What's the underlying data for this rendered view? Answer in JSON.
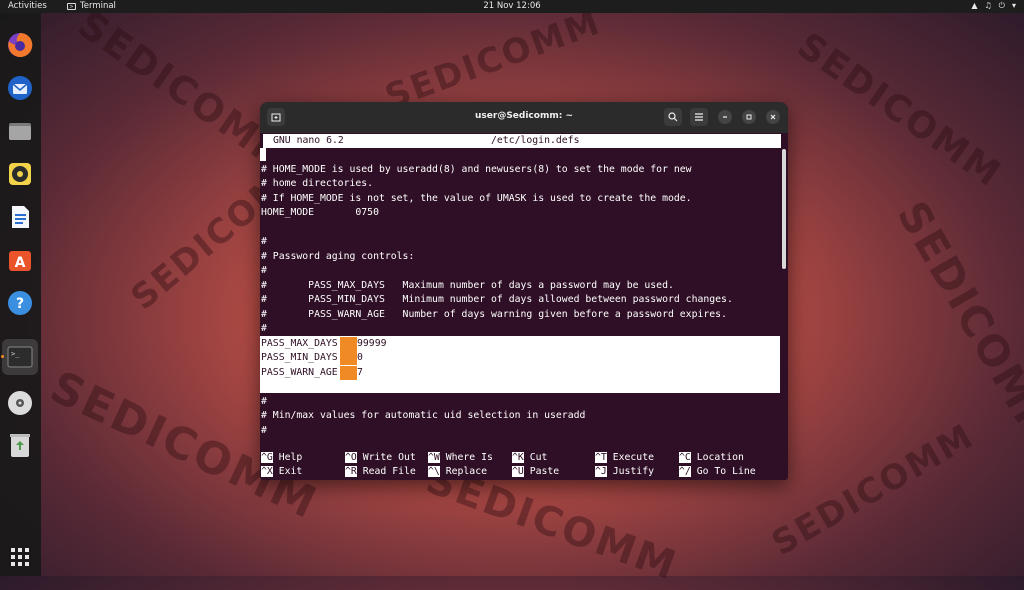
{
  "topbar": {
    "activities": "Activities",
    "app_name": "Terminal",
    "clock": "21 Nov  12:06"
  },
  "watermark": "SEDICOMM",
  "dock": {
    "items": [
      {
        "name": "firefox",
        "icon": "firefox-icon",
        "color": "#e8572a"
      },
      {
        "name": "thunderbird",
        "icon": "thunderbird-icon",
        "color": "#2f7fd8"
      },
      {
        "name": "files",
        "icon": "files-icon",
        "color": "#8a8a8a"
      },
      {
        "name": "rhythmbox",
        "icon": "rhythmbox-icon",
        "color": "#e6c34a"
      },
      {
        "name": "writer",
        "icon": "writer-icon",
        "color": "#2a6fd0"
      },
      {
        "name": "app-center",
        "icon": "app-center-icon",
        "color": "#e9542a"
      },
      {
        "name": "help",
        "icon": "help-icon",
        "color": "#3a8fe0"
      },
      {
        "name": "terminal",
        "icon": "terminal-icon",
        "color": "#3a3a3a"
      },
      {
        "name": "dvd",
        "icon": "disc-icon",
        "color": "#d0d0d0"
      },
      {
        "name": "trash",
        "icon": "trash-icon",
        "color": "#6aa36a"
      }
    ]
  },
  "window": {
    "title": "user@Sedicomm: ~"
  },
  "nano": {
    "version": "GNU nano 6.2",
    "filename": "/etc/login.defs",
    "lines": [
      "# HOME_MODE is used by useradd(8) and newusers(8) to set the mode for new",
      "# home directories.",
      "# If HOME_MODE is not set, the value of UMASK is used to create the mode.",
      "HOME_MODE       0750",
      "",
      "#",
      "# Password aging controls:",
      "#",
      "#       PASS_MAX_DAYS   Maximum number of days a password may be used.",
      "#       PASS_MIN_DAYS   Minimum number of days allowed between password changes.",
      "#       PASS_WARN_AGE   Number of days warning given before a password expires.",
      "#"
    ],
    "highlighted": [
      {
        "key": "PASS_MAX_DAYS",
        "value": "99999"
      },
      {
        "key": "PASS_MIN_DAYS",
        "value": "0"
      },
      {
        "key": "PASS_WARN_AGE",
        "value": "7"
      }
    ],
    "after_lines": [
      "#",
      "# Min/max values for automatic uid selection in useradd",
      "#"
    ],
    "shortcuts_row1": [
      {
        "key": "^G",
        "label": "Help"
      },
      {
        "key": "^O",
        "label": "Write Out"
      },
      {
        "key": "^W",
        "label": "Where Is"
      },
      {
        "key": "^K",
        "label": "Cut"
      },
      {
        "key": "^T",
        "label": "Execute"
      },
      {
        "key": "^C",
        "label": "Location"
      }
    ],
    "shortcuts_row2": [
      {
        "key": "^X",
        "label": "Exit"
      },
      {
        "key": "^R",
        "label": "Read File"
      },
      {
        "key": "^\\",
        "label": "Replace"
      },
      {
        "key": "^U",
        "label": "Paste"
      },
      {
        "key": "^J",
        "label": "Justify"
      },
      {
        "key": "^/",
        "label": "Go To Line"
      }
    ]
  }
}
